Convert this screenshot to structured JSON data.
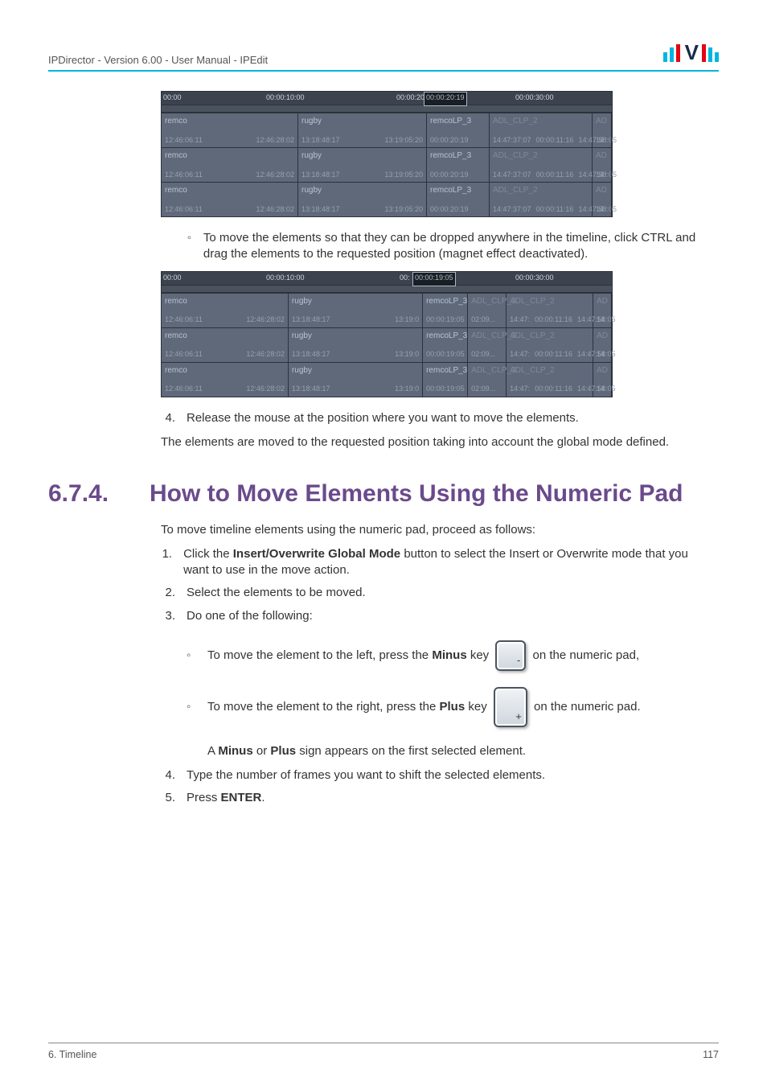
{
  "header": {
    "title": "IPDirector - Version 6.00 - User Manual - IPEdit"
  },
  "footer": {
    "section": "6. Timeline",
    "page": "117"
  },
  "bullet_ctrl": "To move the elements so that they can be dropped anywhere in the timeline, click CTRL and drag the elements to the requested position (magnet effect deactivated).",
  "step4": "Release the mouse at the position where you want to move the elements.",
  "after4": "The elements are moved to the requested position taking into account the global mode defined.",
  "section": {
    "num": "6.7.4.",
    "title": "How to Move Elements Using the Numeric Pad"
  },
  "intro": "To move timeline elements using the numeric pad, proceed as follows:",
  "s1a": "Click the ",
  "s1b": "Insert/Overwrite Global Mode",
  "s1c": " button to select the Insert or Overwrite mode that you want to use in the move action.",
  "s2": "Select the elements to be moved.",
  "s3": "Do one of the following:",
  "s3a_a": "To move the element to the left, press the ",
  "s3a_b": "Minus",
  "s3a_c": " key ",
  "s3a_d": " on the numeric pad,",
  "s3b_a": "To move the element to the right, press the ",
  "s3b_b": "Plus",
  "s3b_c": " key ",
  "s3b_d": " on the numeric pad.",
  "s3_note_a": "A ",
  "s3_note_b": "Minus",
  "s3_note_c": " or ",
  "s3_note_d": "Plus",
  "s3_note_e": " sign appears on the first selected element.",
  "s4": "Type the number of frames you want to shift the selected elements.",
  "s5a": "Press ",
  "s5b": "ENTER",
  "s5c": ".",
  "ruler1": {
    "t0": "00:00",
    "t1": "00:00:10:00",
    "t2": "00:00:20",
    "marker": "00:00:20:19",
    "t3": "00:00:30:00"
  },
  "ruler2": {
    "t0": "00:00",
    "t1": "00:00:10:00",
    "t2": "00:",
    "marker": "00:00:19:05",
    "t3": "00:00:30:00"
  },
  "clip": {
    "remco": "remco",
    "rugby": "rugby",
    "remco3": "remcoLP_3",
    "adl3": "ADL_CLP_3",
    "adl2": "ADL_CLP_2",
    "ad": "AD",
    "tc_a1": "12:46:06:11",
    "tc_a2": "12:46:28:02",
    "tc_b1": "13:18:48:17",
    "tc_b2": "13:19:05:20",
    "tc_c1": "00:00:20:19",
    "tc_d1": "14:47:37:07",
    "tc_d2": "00:00:11:16",
    "tc_d3": "14:47:58:05",
    "tc_e": "14",
    "tc2_b2": "13:19:0",
    "tc2_c1": "00:00:19:05",
    "tc2_cx": "02:09...",
    "tc2_d1": "14:47:",
    "tc2_d2": "00:00:11:16",
    "tc2_d3": "14:47:58:05"
  }
}
